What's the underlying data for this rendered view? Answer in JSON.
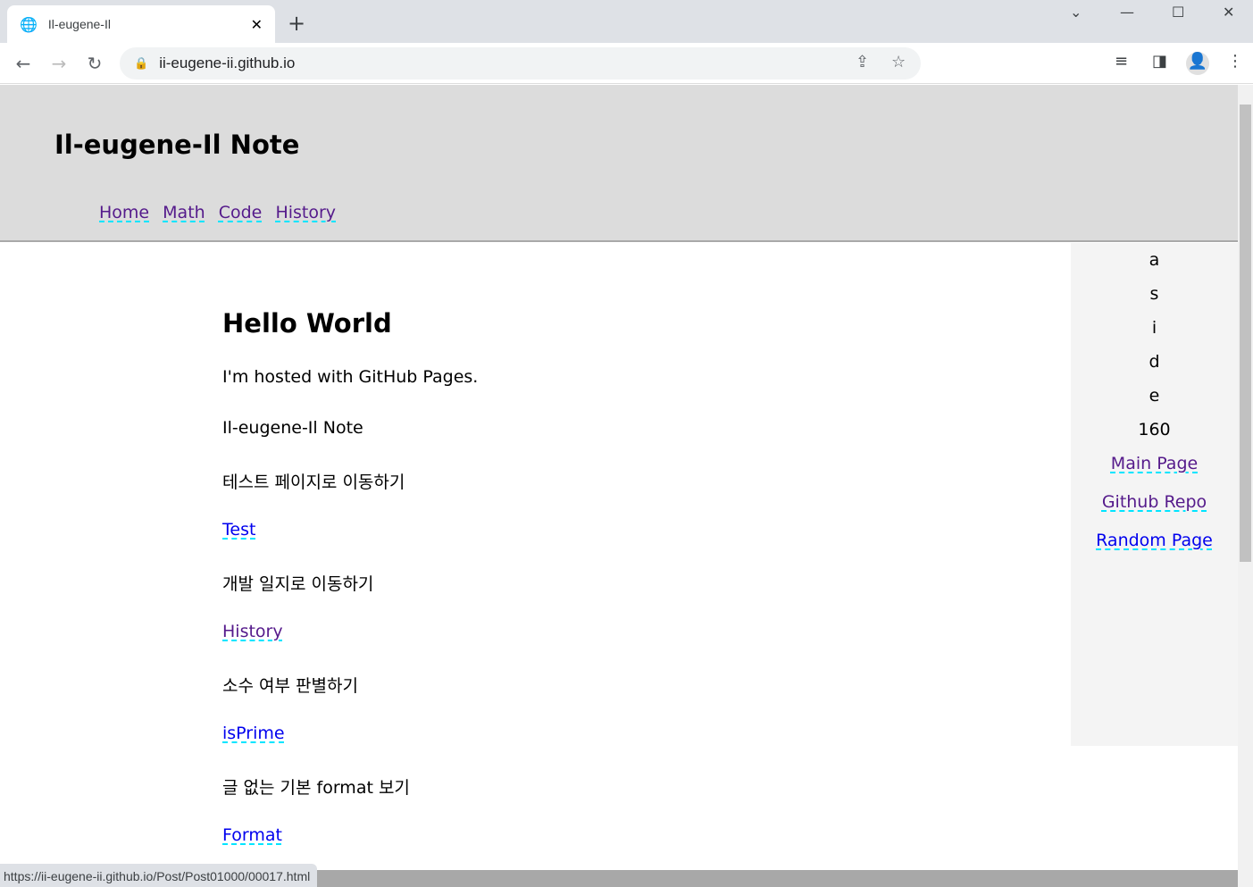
{
  "browser": {
    "tab_title": "Il-eugene-Il",
    "url": "ii-eugene-ii.github.io",
    "status_url": "https://ii-eugene-ii.github.io/Post/Post01000/00017.html"
  },
  "header": {
    "title": "Il-eugene-Il Note",
    "nav": [
      {
        "label": "Home"
      },
      {
        "label": "Math"
      },
      {
        "label": "Code"
      },
      {
        "label": "History"
      }
    ]
  },
  "main": {
    "heading": "Hello World",
    "intro": "I'm hosted with GitHub Pages.",
    "subtitle": "Il-eugene-Il Note",
    "sections": [
      {
        "text": "테스트 페이지로 이동하기",
        "link": "Test",
        "visited": false
      },
      {
        "text": "개발 일지로 이동하기",
        "link": "History",
        "visited": true
      },
      {
        "text": "소수 여부 판별하기",
        "link": "isPrime",
        "visited": false
      },
      {
        "text": "글 없는 기본 format 보기",
        "link": "Format",
        "visited": false
      }
    ]
  },
  "aside": {
    "letters": [
      "a",
      "s",
      "i",
      "d",
      "e",
      "160"
    ],
    "links": [
      {
        "label": "Main Page",
        "visited": true
      },
      {
        "label": "Github Repo",
        "visited": true
      },
      {
        "label": "Random Page",
        "visited": false
      }
    ]
  },
  "colors": {
    "visited": "#551a8b",
    "link": "#0000ee",
    "underline": "#00e5ff",
    "header_bg": "#dcdcdc",
    "aside_bg": "#f4f4f4"
  }
}
